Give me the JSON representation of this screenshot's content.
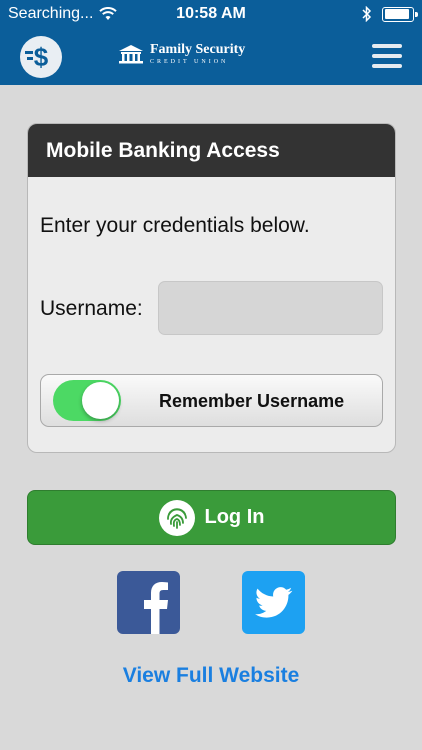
{
  "status_bar": {
    "carrier": "Searching...",
    "time": "10:58 AM",
    "battery_level": 0.9
  },
  "header": {
    "logo_name": "Family Security",
    "logo_subtitle": "CREDIT UNION",
    "left_icon": "dollar-transfer-icon",
    "right_icon": "hamburger-menu-icon"
  },
  "card": {
    "title": "Mobile Banking Access",
    "instruction": "Enter your credentials below.",
    "username_label": "Username:",
    "username_value": "",
    "remember_label": "Remember Username",
    "remember_on": true
  },
  "login": {
    "label": "Log In",
    "icon": "fingerprint-icon"
  },
  "social": {
    "facebook_icon": "facebook-icon",
    "twitter_icon": "twitter-icon"
  },
  "full_site_link": "View Full Website",
  "colors": {
    "brand_blue": "#0b5e9a",
    "login_green": "#3a9b3a",
    "toggle_green": "#4cd964",
    "link_blue": "#1a7fe0",
    "facebook_blue": "#3b5998",
    "twitter_blue": "#1da1f2"
  }
}
